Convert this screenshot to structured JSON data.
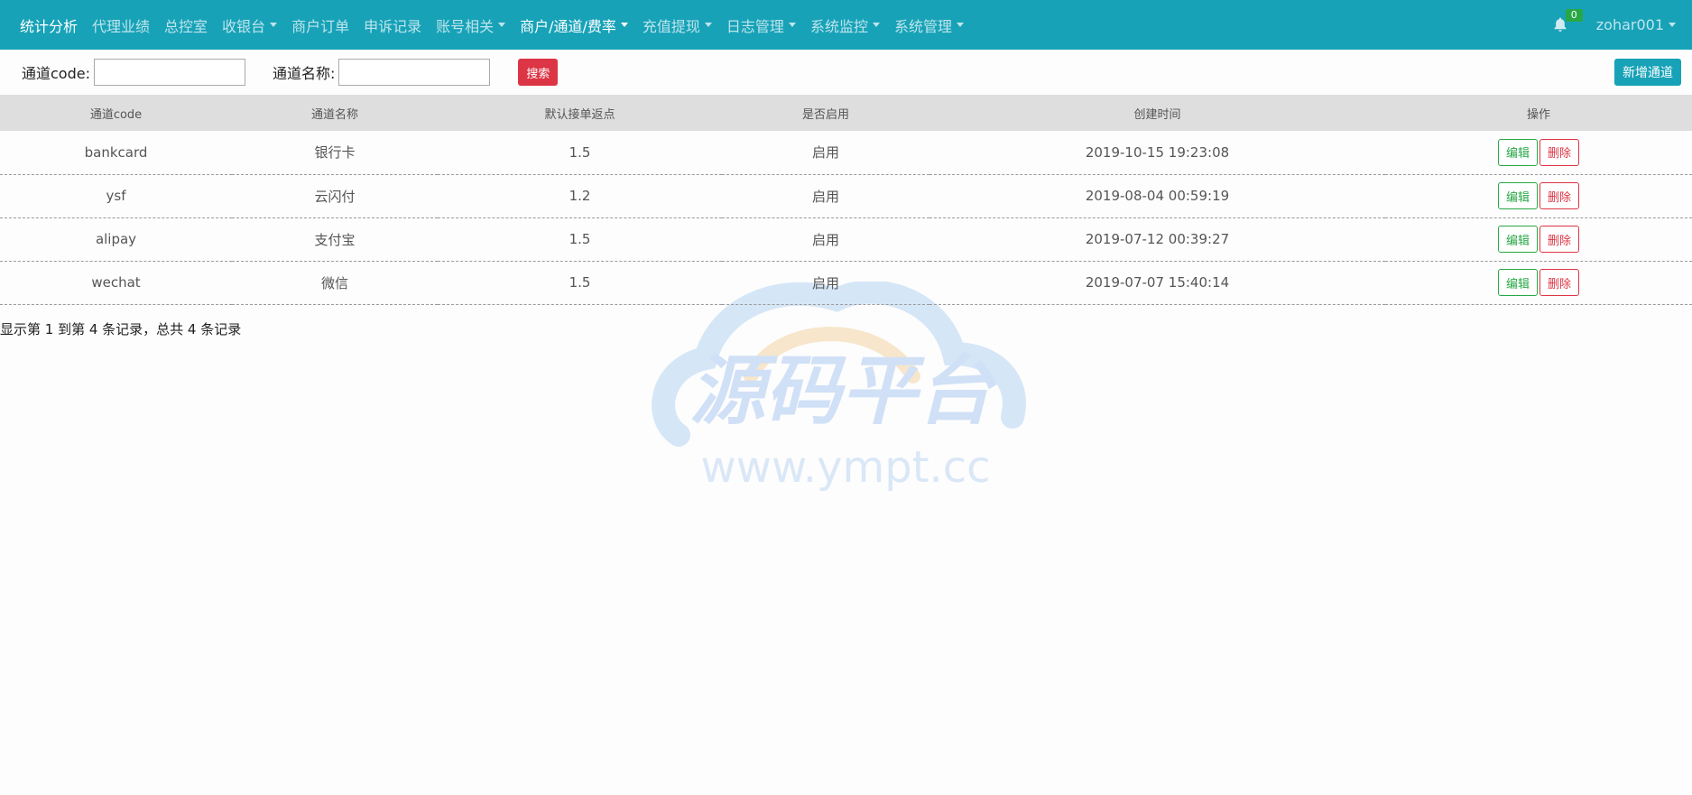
{
  "nav": {
    "items": [
      {
        "label": "统计分析",
        "dropdown": false,
        "active": true
      },
      {
        "label": "代理业绩",
        "dropdown": false,
        "active": false
      },
      {
        "label": "总控室",
        "dropdown": false,
        "active": false
      },
      {
        "label": "收银台",
        "dropdown": true,
        "active": false
      },
      {
        "label": "商户订单",
        "dropdown": false,
        "active": false
      },
      {
        "label": "申诉记录",
        "dropdown": false,
        "active": false
      },
      {
        "label": "账号相关",
        "dropdown": true,
        "active": false
      },
      {
        "label": "商户/通道/费率",
        "dropdown": true,
        "active": true
      },
      {
        "label": "充值提现",
        "dropdown": true,
        "active": false
      },
      {
        "label": "日志管理",
        "dropdown": true,
        "active": false
      },
      {
        "label": "系统监控",
        "dropdown": true,
        "active": false
      },
      {
        "label": "系统管理",
        "dropdown": true,
        "active": false
      }
    ],
    "notification_count": "0",
    "user": "zohar001"
  },
  "search": {
    "code_label": "通道code:",
    "code_value": "",
    "name_label": "通道名称:",
    "name_value": "",
    "search_button": "搜索",
    "add_button": "新增通道"
  },
  "table": {
    "headers": [
      "通道code",
      "通道名称",
      "默认接单返点",
      "是否启用",
      "创建时间",
      "操作"
    ],
    "rows": [
      {
        "code": "bankcard",
        "name": "银行卡",
        "rebate": "1.5",
        "enabled": "启用",
        "created": "2019-10-15 19:23:08"
      },
      {
        "code": "ysf",
        "name": "云闪付",
        "rebate": "1.2",
        "enabled": "启用",
        "created": "2019-08-04 00:59:19"
      },
      {
        "code": "alipay",
        "name": "支付宝",
        "rebate": "1.5",
        "enabled": "启用",
        "created": "2019-07-12 00:39:27"
      },
      {
        "code": "wechat",
        "name": "微信",
        "rebate": "1.5",
        "enabled": "启用",
        "created": "2019-07-07 15:40:14"
      }
    ],
    "edit_label": "编辑",
    "delete_label": "删除"
  },
  "pagination": {
    "info": "显示第 1 到第 4 条记录，总共 4 条记录"
  },
  "watermark": {
    "title": "源码平台",
    "url": "www.ympt.cc"
  },
  "colors": {
    "nav_bg": "#17a2b8",
    "header_bg": "#dedede",
    "danger": "#dc3545",
    "success": "#28a745"
  },
  "icons": {
    "bell": "bell-icon",
    "caret": "caret-down-icon"
  }
}
